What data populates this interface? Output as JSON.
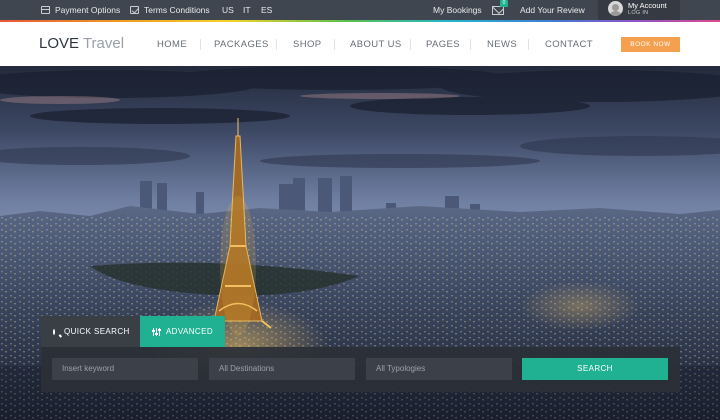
{
  "topbar": {
    "payment_options": "Payment Options",
    "terms_conditions": "Terms Conditions",
    "languages": [
      "US",
      "IT",
      "ES"
    ],
    "my_bookings": "My Bookings",
    "bookings_badge": "0",
    "add_review": "Add Your Review",
    "account_name": "My Account",
    "account_login": "LOG IN"
  },
  "nav": {
    "logo_bold": "LOVE",
    "logo_light": "Travel",
    "items": [
      "HOME",
      "PACKAGES",
      "SHOP",
      "ABOUT US",
      "PAGES",
      "NEWS",
      "CONTACT"
    ],
    "book_now": "BOOK NOW"
  },
  "search": {
    "tab_quick": "QUICK SEARCH",
    "tab_advanced": "ADVANCED",
    "keyword_placeholder": "Insert keyword",
    "destinations_placeholder": "All Destinations",
    "typologies_placeholder": "All Typologies",
    "button": "SEARCH"
  },
  "colors": {
    "accent_green": "#1fb192",
    "book_orange": "#f5a04e",
    "topbar_bg": "#40464f"
  },
  "icons": {
    "payment": "credit-card-icon",
    "terms": "checkbox-icon",
    "bookings": "mail-icon",
    "account": "avatar",
    "quick_search": "search-icon",
    "advanced": "sliders-icon"
  }
}
